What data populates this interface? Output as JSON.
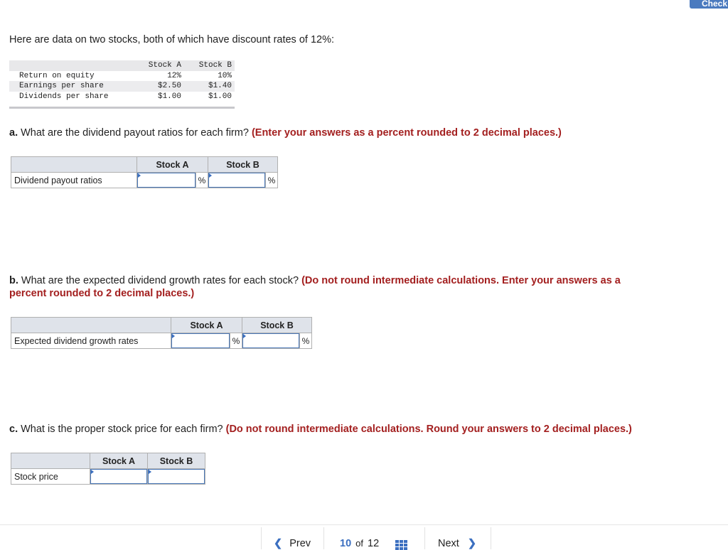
{
  "header": {
    "check_button_label": "Check"
  },
  "intro_text": "Here are data on two stocks, both of which have discount rates of 12%:",
  "data_table": {
    "columns": [
      "",
      "Stock A",
      "Stock B"
    ],
    "rows": [
      {
        "label": "Return on equity",
        "stock_a": "12%",
        "stock_b": "10%"
      },
      {
        "label": "Earnings per share",
        "stock_a": "$2.50",
        "stock_b": "$1.40"
      },
      {
        "label": "Dividends per share",
        "stock_a": "$1.00",
        "stock_b": "$1.00"
      }
    ]
  },
  "questions": {
    "a": {
      "lead": "a.",
      "text": " What are the dividend payout ratios for each firm? ",
      "instruction": "(Enter your answers as a percent rounded to 2 decimal places.)",
      "table": {
        "col_a": "Stock A",
        "col_b": "Stock B",
        "row_label": "Dividend payout ratios",
        "value_a": "",
        "value_b": "",
        "unit": "%"
      }
    },
    "b": {
      "lead": "b.",
      "text": " What are the expected dividend growth rates for each stock? ",
      "instruction": "(Do not round intermediate calculations. Enter your answers as a percent rounded to 2 decimal places.)",
      "table": {
        "col_a": "Stock A",
        "col_b": "Stock B",
        "row_label": "Expected dividend growth rates",
        "value_a": "",
        "value_b": "",
        "unit": "%"
      }
    },
    "c": {
      "lead": "c.",
      "text": " What is the proper stock price for each firm? ",
      "instruction": "(Do not round intermediate calculations. Round your answers to 2 decimal places.)",
      "table": {
        "col_a": "Stock A",
        "col_b": "Stock B",
        "row_label": "Stock price",
        "value_a": "",
        "value_b": ""
      }
    }
  },
  "pager": {
    "prev_label": "Prev",
    "current_page": "10",
    "of_label": "of",
    "total_pages": "12",
    "next_label": "Next",
    "prev_icon": "chevron-left-icon",
    "next_icon": "chevron-right-icon",
    "grid_icon": "grid-icon"
  },
  "colors": {
    "instruction_red": "#a31f1f",
    "accent_blue": "#3b6fc0",
    "table_header_bg": "#dfe3ea"
  }
}
